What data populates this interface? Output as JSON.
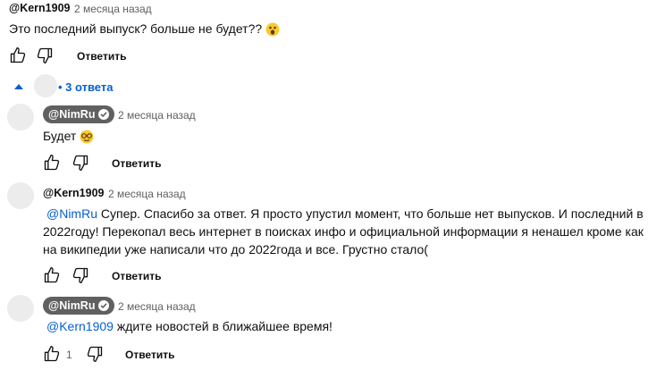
{
  "comments": [
    {
      "author": "@Kern1909",
      "time": "2 месяца назад",
      "text": "Это последний выпуск? больше не будет??",
      "emoji": "astonished-face",
      "reply_label": "Ответить"
    },
    {
      "author": "@NimRu",
      "time": "2 месяца назад",
      "text": "Будет",
      "emoji": "nerd-face",
      "reply_label": "Ответить"
    },
    {
      "author": "@Kern1909",
      "time": "2 месяца назад",
      "mention": "@NimRu",
      "lines": [
        "Супер. Спасибо за ответ. Я просто упустил момент,  что больше нет выпусков. И последний в",
        "2022году! Перекопал весь интернет в поисках инфо и официальной информации я ненашел кроме как",
        "на википедии уже написали что до 2022года и все. Грустно стало("
      ],
      "reply_label": "Ответить"
    },
    {
      "author": "@NimRu",
      "time": "2 месяца назад",
      "mention": "@Kern1909",
      "text": "ждите новостей в ближайшее время!",
      "likes": "1",
      "reply_label": "Ответить"
    }
  ],
  "replies_toggle": {
    "label": "• 3 ответа"
  },
  "colors": {
    "link": "#065fd4",
    "badge": "#606060",
    "avatar": "#ececec"
  }
}
